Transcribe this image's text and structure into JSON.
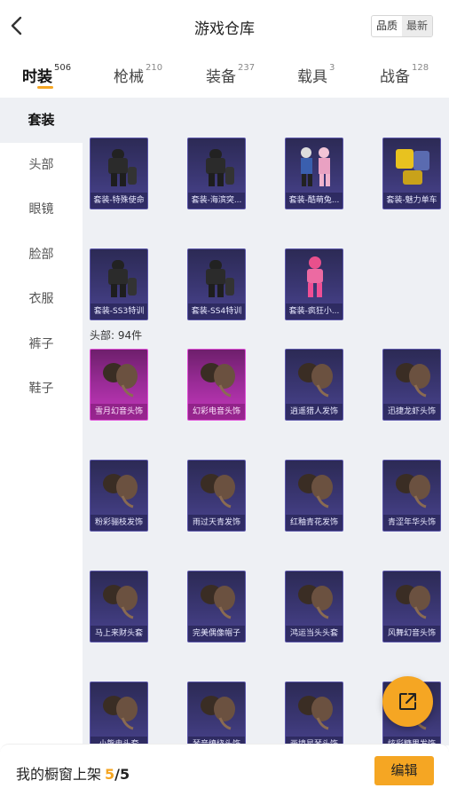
{
  "header": {
    "title": "游戏仓库",
    "sort_quality": "品质",
    "sort_latest": "最新"
  },
  "tabs": [
    {
      "label": "时装",
      "count": "506"
    },
    {
      "label": "枪械",
      "count": "210"
    },
    {
      "label": "装备",
      "count": "237"
    },
    {
      "label": "载具",
      "count": "3"
    },
    {
      "label": "战备",
      "count": "128"
    }
  ],
  "sidebar": [
    "套装",
    "头部",
    "眼镜",
    "脸部",
    "衣服",
    "裤子",
    "鞋子"
  ],
  "section_head": "头部: 94件",
  "sets": [
    {
      "caption": "套装-特殊使命",
      "kind": "suit"
    },
    {
      "caption": "套装-海滨突...",
      "kind": "suit"
    },
    {
      "caption": "套装-酷萌兔...",
      "kind": "duo"
    },
    {
      "caption": "套装-魅力单车",
      "kind": "yellow"
    },
    {
      "caption": "套装-SS3特训",
      "kind": "suit"
    },
    {
      "caption": "套装-SS4特训",
      "kind": "suit"
    },
    {
      "caption": "套装-疯狂小...",
      "kind": "pink"
    }
  ],
  "heads": [
    {
      "caption": "雪月幻音头饰",
      "rarity": "pink"
    },
    {
      "caption": "幻彩电音头饰",
      "rarity": "pink"
    },
    {
      "caption": "逍遥猎人发饰",
      "rarity": "purple"
    },
    {
      "caption": "迅捷龙虾头饰",
      "rarity": "purple"
    },
    {
      "caption": "粉彩骊枝发饰",
      "rarity": "purple"
    },
    {
      "caption": "雨过天青发饰",
      "rarity": "purple"
    },
    {
      "caption": "红釉青花发饰",
      "rarity": "purple"
    },
    {
      "caption": "青涩年华头饰",
      "rarity": "purple"
    },
    {
      "caption": "马上来财头套",
      "rarity": "purple"
    },
    {
      "caption": "完美偶像帽子",
      "rarity": "purple"
    },
    {
      "caption": "鸿运当头头套",
      "rarity": "purple"
    },
    {
      "caption": "风舞幻音头饰",
      "rarity": "purple"
    },
    {
      "caption": "小熊电头套",
      "rarity": "purple"
    },
    {
      "caption": "琴音缭绕头饰",
      "rarity": "purple"
    },
    {
      "caption": "画境星琴头饰",
      "rarity": "purple"
    },
    {
      "caption": "炫彩糖果发饰",
      "rarity": "purple"
    }
  ],
  "bottom": {
    "label": "我的橱窗上架",
    "current": "5",
    "sep": "/",
    "max": "5",
    "edit": "编辑"
  },
  "colors": {
    "accent": "#f5a623",
    "card_purple": "#3b3774",
    "card_pink": "#c538bd",
    "panel_bg": "#eef0f4"
  }
}
